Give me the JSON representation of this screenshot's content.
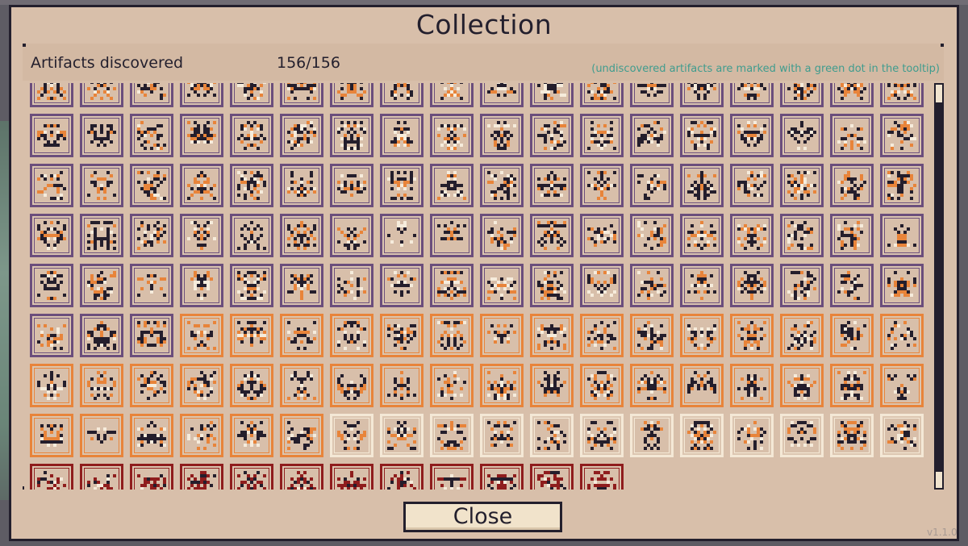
{
  "window": {
    "title": "Collection"
  },
  "header": {
    "label": "Artifacts discovered",
    "count": "156/156",
    "hint": "(undiscovered artifacts are marked with a green dot in the tooltip)"
  },
  "collection": {
    "tiers": [
      {
        "border_color": "#6b4e7c",
        "count": 93,
        "icon_colors": [
          "#241e2c",
          "#e8843a",
          "#f6ecdc"
        ]
      },
      {
        "border_color": "#e8843a",
        "count": 39,
        "icon_colors": [
          "#241e2c",
          "#e8843a",
          "#f6ecdc"
        ]
      },
      {
        "border_color": "#f4e8d6",
        "count": 12,
        "icon_colors": [
          "#241e2c",
          "#e8843a",
          "#f6ecdc"
        ]
      },
      {
        "border_color": "#8f1d1d",
        "count": 12,
        "icon_colors": [
          "#8f1d1d",
          "#241e2c",
          "#f6ecdc"
        ]
      }
    ]
  },
  "close_button": {
    "label": "Close"
  },
  "version": "v1.1.0",
  "colors": {
    "panel": "#d8bfaa",
    "ink": "#231f2d",
    "hint": "#3f9c8e",
    "button": "#f1e3cb"
  }
}
